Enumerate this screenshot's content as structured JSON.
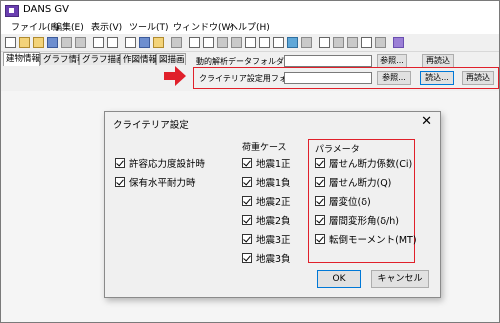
{
  "window": {
    "title": "DANS GV"
  },
  "menu": [
    "ファイル(F)",
    "編集(E)",
    "表示(V)",
    "ツール(T)",
    "ウィンドウ(W)",
    "ヘルプ(H)"
  ],
  "tabs": [
    "建物情報",
    "グラフ情報",
    "グラフ描画",
    "作図情報",
    "図描画"
  ],
  "folder_rows": [
    {
      "label": "動的解析データフォルダ",
      "value": "",
      "browse_label": "参照...",
      "reload_label": "再読込"
    },
    {
      "label": "クライテリア設定用フォルダ",
      "value": "",
      "browse_label": "参照...",
      "load_label": "読込...",
      "reload_label": "再読込"
    }
  ],
  "dialog": {
    "title": "クライテリア設定",
    "close_glyph": "✕",
    "left_options": [
      {
        "label": "許容応力度設計時",
        "checked": true
      },
      {
        "label": "保有水平耐力時",
        "checked": true
      }
    ],
    "load_cases": {
      "title": "荷重ケース",
      "items": [
        {
          "label": "地震1正",
          "checked": true
        },
        {
          "label": "地震1負",
          "checked": true
        },
        {
          "label": "地震2正",
          "checked": true
        },
        {
          "label": "地震2負",
          "checked": true
        },
        {
          "label": "地震3正",
          "checked": true
        },
        {
          "label": "地震3負",
          "checked": true
        }
      ]
    },
    "parameters": {
      "title": "パラメータ",
      "items": [
        {
          "label": "層せん断力係数(Ci)",
          "checked": true
        },
        {
          "label": "層せん断力(Q)",
          "checked": true
        },
        {
          "label": "層変位(δ)",
          "checked": true
        },
        {
          "label": "層間変形角(δ/h)",
          "checked": true
        },
        {
          "label": "転倒モーメント(MT)",
          "checked": true
        }
      ]
    },
    "ok_label": "OK",
    "cancel_label": "キャンセル"
  },
  "colors": {
    "highlight": "#e0202a",
    "focus": "#0078d7"
  }
}
